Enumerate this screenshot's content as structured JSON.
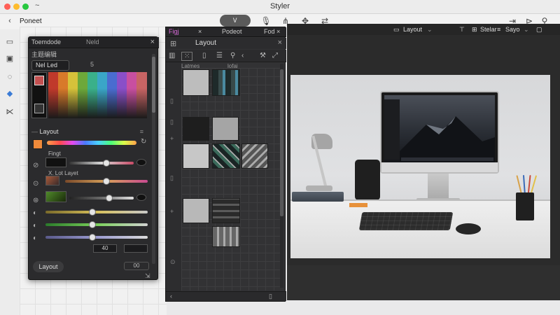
{
  "window": {
    "title": "Styler",
    "tilde": "~",
    "traffic": {
      "close": "#ff5f57",
      "minimize": "#febc2e",
      "zoom": "#28c840"
    }
  },
  "toolbar": {
    "center_button": "Ꮩ",
    "icons": [
      "microphone-icon",
      "hierarchy-icon",
      "move-arrows-icon",
      "fast-forward-icon",
      "skip-icon",
      "bookmark-icon"
    ]
  },
  "breadcrumb": "Poneet",
  "color_panel": {
    "tab_active": "Toemdode",
    "tab_inactive": "Neld",
    "subtitle": "主题编辑",
    "preset_label": "Nel Led",
    "preset_value": "5",
    "section_title": "Layout",
    "label_target": "Fingt",
    "label_layer": "X. Lot Layet",
    "button_a": "40",
    "button_b": "",
    "layout_button": "Layout",
    "layout_value": "00",
    "hue_colors": [
      "#c0392b",
      "#d87a2a",
      "#d6c23a",
      "#6da83a",
      "#3ab08a",
      "#3aa6c8",
      "#4a6cd0",
      "#8a4fc8",
      "#c84fa0",
      "#c86464"
    ],
    "sliders": [
      {
        "name": "hue",
        "value": 0.82
      },
      {
        "name": "dark",
        "value": 0.58
      },
      {
        "name": "warm",
        "value": 0.5
      },
      {
        "name": "contrast",
        "value": 0.62
      },
      {
        "name": "tone1",
        "value": 0.46
      },
      {
        "name": "tone2",
        "value": 0.46
      },
      {
        "name": "tone3",
        "value": 0.46
      }
    ]
  },
  "layers_panel": {
    "tabs": [
      "Figj",
      "Podeot",
      "Fod"
    ],
    "header": "Layout",
    "sub_labels": [
      "Latmes",
      "lofai"
    ]
  },
  "viewer": {
    "layout_label": "Layout",
    "right_labels": [
      "Stelar",
      "Sayo"
    ]
  }
}
